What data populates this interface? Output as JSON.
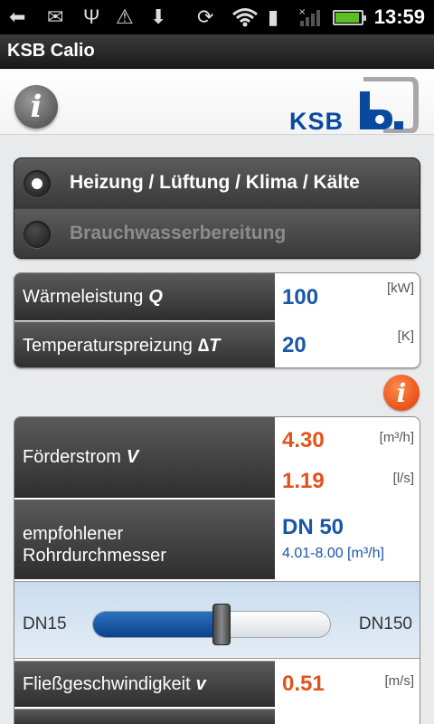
{
  "status_bar": {
    "time": "13:59",
    "icons": [
      "back-icon",
      "mail-icon",
      "usb-icon",
      "warning-icon",
      "download-icon",
      "rotate-icon",
      "wifi-icon",
      "sd-card-icon",
      "no-signal-icon",
      "battery-icon"
    ]
  },
  "app": {
    "title": "KSB Calio"
  },
  "header": {
    "logo_text": "KSB",
    "info_glyph": "i"
  },
  "mode": {
    "options": [
      {
        "label": "Heizung / Lüftung / Klima / Kälte",
        "selected": true
      },
      {
        "label": "Brauchwasserbereitung",
        "selected": false
      }
    ]
  },
  "inputs": {
    "power": {
      "label": "Wärmeleistung",
      "symbol": "Q",
      "value": "100",
      "unit": "[kW]"
    },
    "spread": {
      "label": "Temperaturspreizung",
      "symbol": "∆T",
      "value": "20",
      "unit": "[K]"
    }
  },
  "results": {
    "flow": {
      "label": "Förderstrom",
      "symbol": "V",
      "value_m3h": "4.30",
      "unit_m3h": "[m³/h]",
      "value_ls": "1.19",
      "unit_ls": "[l/s]"
    },
    "diameter": {
      "label_line1": "empfohlener",
      "label_line2": "Rohrdurchmesser",
      "value": "DN 50",
      "range": "4.01-8.00 [m³/h]"
    },
    "slider": {
      "min_label": "DN15",
      "max_label": "DN150",
      "level": 0.54
    },
    "velocity": {
      "label": "Fließgeschwindigkeit",
      "symbol": "v",
      "value": "0.51",
      "unit": "[m/s]"
    }
  },
  "colors": {
    "accent_orange": "#e2531c",
    "value_blue": "#1a56a8",
    "brand_blue": "#0a4a9e"
  }
}
